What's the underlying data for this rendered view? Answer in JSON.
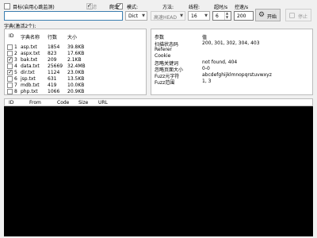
{
  "top": {
    "target_label": "目标(启用心跳监测)",
    "filter_label": "过滤",
    "crawler_label": "爬虫",
    "url_value": "",
    "mode_label": "模式:",
    "mode_value": "Dict",
    "method_label": "方法:",
    "method_value": "高速HEAD",
    "threads_label": "线程:",
    "threads_value": "16",
    "timeout_label": "超时/s",
    "timeout_value": "6",
    "rate_label": "控速/s",
    "rate_value": "200",
    "start_label": "开始",
    "stop_label": "停止"
  },
  "dict": {
    "label": "字典(激活2个):",
    "headers": {
      "id": "ID",
      "name": "字典名称",
      "lines": "行数",
      "size": "大小"
    },
    "rows": [
      {
        "id": "1",
        "name": "asp.txt",
        "lines": "1854",
        "size": "39.8KB",
        "checked": false
      },
      {
        "id": "2",
        "name": "aspx.txt",
        "lines": "823",
        "size": "17.6KB",
        "checked": false
      },
      {
        "id": "3",
        "name": "bak.txt",
        "lines": "209",
        "size": "2.1KB",
        "checked": true
      },
      {
        "id": "4",
        "name": "data.txt",
        "lines": "25669",
        "size": "32.4MB",
        "checked": false
      },
      {
        "id": "5",
        "name": "dir.txt",
        "lines": "1124",
        "size": "23.0KB",
        "checked": true
      },
      {
        "id": "6",
        "name": "jsp.txt",
        "lines": "631",
        "size": "13.5KB",
        "checked": false
      },
      {
        "id": "7",
        "name": "mdb.txt",
        "lines": "419",
        "size": "10.0KB",
        "checked": false
      },
      {
        "id": "8",
        "name": "php.txt",
        "lines": "1066",
        "size": "20.9KB",
        "checked": false
      }
    ]
  },
  "params": {
    "headers": {
      "param": "参数",
      "value": "值"
    },
    "rows": [
      {
        "param": "扫描状态码",
        "value": "200, 301, 302, 304, 403"
      },
      {
        "param": "Referer",
        "value": ""
      },
      {
        "param": "Cookie",
        "value": ""
      },
      {
        "param": "忽略关键词",
        "value": "not found, 404"
      },
      {
        "param": "忽略页面大小",
        "value": "0-0"
      },
      {
        "param": "Fuzz元字符",
        "value": "abcdefghijklmnopqrstuvwxyz"
      },
      {
        "param": "Fuzz范围",
        "value": "1, 3"
      }
    ]
  },
  "results": {
    "headers": {
      "id": "ID",
      "from": "From",
      "code": "Code",
      "size": "Size",
      "url": "URL"
    },
    "rows": []
  }
}
